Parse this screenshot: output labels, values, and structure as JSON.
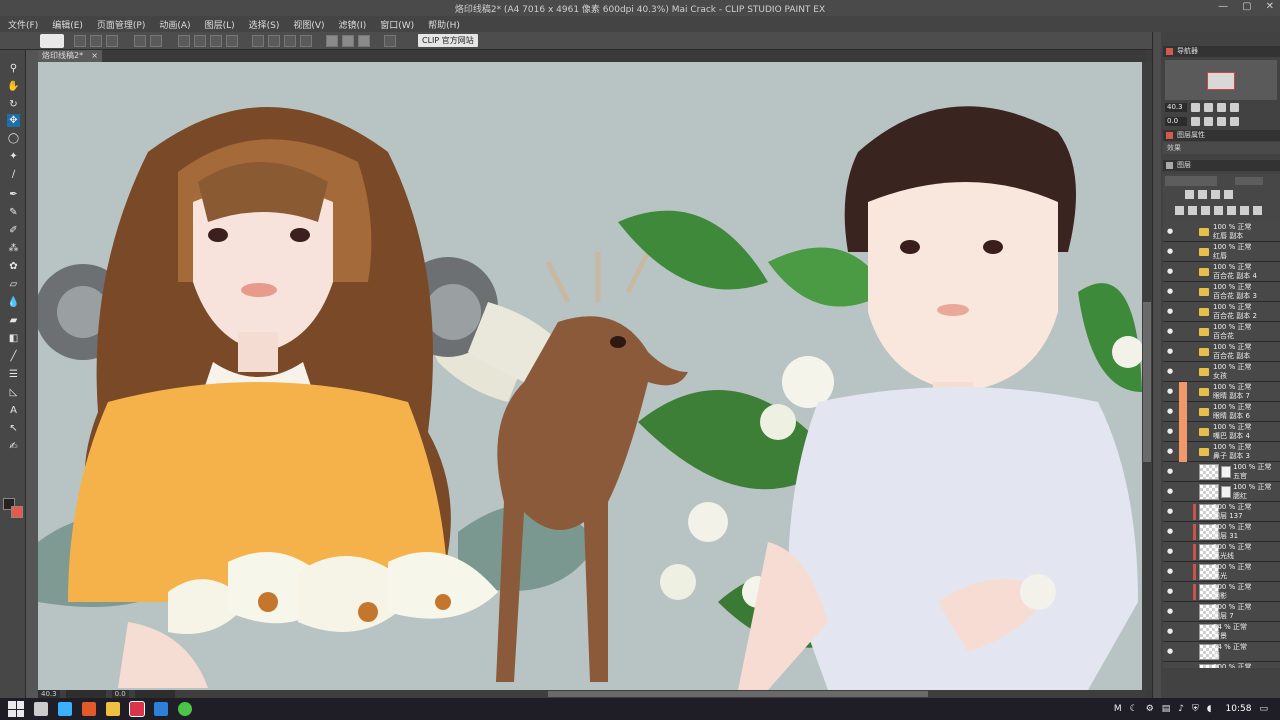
{
  "window": {
    "title": "烙印线稿2* (A4 7016 x 4961 像素 600dpi 40.3%)   Mai Crack - CLIP STUDIO PAINT EX"
  },
  "menu": [
    "文件(F)",
    "编辑(E)",
    "页面管理(P)",
    "动画(A)",
    "图层(L)",
    "选择(S)",
    "视图(V)",
    "滤镜(I)",
    "窗口(W)",
    "帮助(H)"
  ],
  "toolbar": {
    "clip_link": "CLIP 官方网站"
  },
  "document_tab": {
    "label": "烙印线稿2*",
    "close": "×"
  },
  "status": {
    "zoom": "40.3",
    "angle": "0.0"
  },
  "navigator": {
    "title": "导航器",
    "zoom": "40.3",
    "angle": "0.0"
  },
  "properties": {
    "title": "图层属性",
    "effects": "效果"
  },
  "layer_panel": {
    "title": "图层",
    "blend_placeholder": "",
    "layers": [
      {
        "opacity": "100 %",
        "mode": "正常",
        "name": "红唇 副本",
        "type": "folder"
      },
      {
        "opacity": "100 %",
        "mode": "正常",
        "name": "红唇",
        "type": "folder"
      },
      {
        "opacity": "100 %",
        "mode": "正常",
        "name": "百合花 副本 4",
        "type": "folder"
      },
      {
        "opacity": "100 %",
        "mode": "正常",
        "name": "百合花 副本 3",
        "type": "folder"
      },
      {
        "opacity": "100 %",
        "mode": "正常",
        "name": "百合花 副本 2",
        "type": "folder"
      },
      {
        "opacity": "100 %",
        "mode": "正常",
        "name": "百合花",
        "type": "folder"
      },
      {
        "opacity": "100 %",
        "mode": "正常",
        "name": "百合花 副本",
        "type": "folder"
      },
      {
        "opacity": "100 %",
        "mode": "正常",
        "name": "女孩",
        "type": "folder-open"
      },
      {
        "opacity": "100 %",
        "mode": "正常",
        "name": "眼睛 副本 7",
        "type": "folder"
      },
      {
        "opacity": "100 %",
        "mode": "正常",
        "name": "眼睛 副本 6",
        "type": "folder"
      },
      {
        "opacity": "100 %",
        "mode": "正常",
        "name": "嘴巴 副本 4",
        "type": "folder"
      },
      {
        "opacity": "100 %",
        "mode": "正常",
        "name": "鼻子 副本 3",
        "type": "folder"
      },
      {
        "opacity": "100 %",
        "mode": "正常",
        "name": "五官",
        "type": "layer"
      },
      {
        "opacity": "100 %",
        "mode": "正常",
        "name": "腮红",
        "type": "layer"
      },
      {
        "opacity": "100 %",
        "mode": "正常",
        "name": "图层 137",
        "type": "layer"
      },
      {
        "opacity": "100 %",
        "mode": "正常",
        "name": "图层 31",
        "type": "layer"
      },
      {
        "opacity": "100 %",
        "mode": "正常",
        "name": "高光线",
        "type": "layer"
      },
      {
        "opacity": "100 %",
        "mode": "正常",
        "name": "高光",
        "type": "layer"
      },
      {
        "opacity": "100 %",
        "mode": "正常",
        "name": "阴影",
        "type": "layer"
      },
      {
        "opacity": "100 %",
        "mode": "正常",
        "name": "图层 7",
        "type": "layer"
      },
      {
        "opacity": "54 %",
        "mode": "正常",
        "name": "背景",
        "type": "layer"
      },
      {
        "opacity": "54 %",
        "mode": "正常",
        "name": "眉",
        "type": "layer"
      },
      {
        "opacity": "100 %",
        "mode": "正常",
        "name": "线稿",
        "type": "layer"
      }
    ]
  },
  "taskbar": {
    "time": "10:58",
    "ime": "M"
  },
  "colors": {
    "canvas_bg": "#b8c4c3",
    "accent": "#1e6fa8",
    "layer_mark": "#f0986a"
  }
}
